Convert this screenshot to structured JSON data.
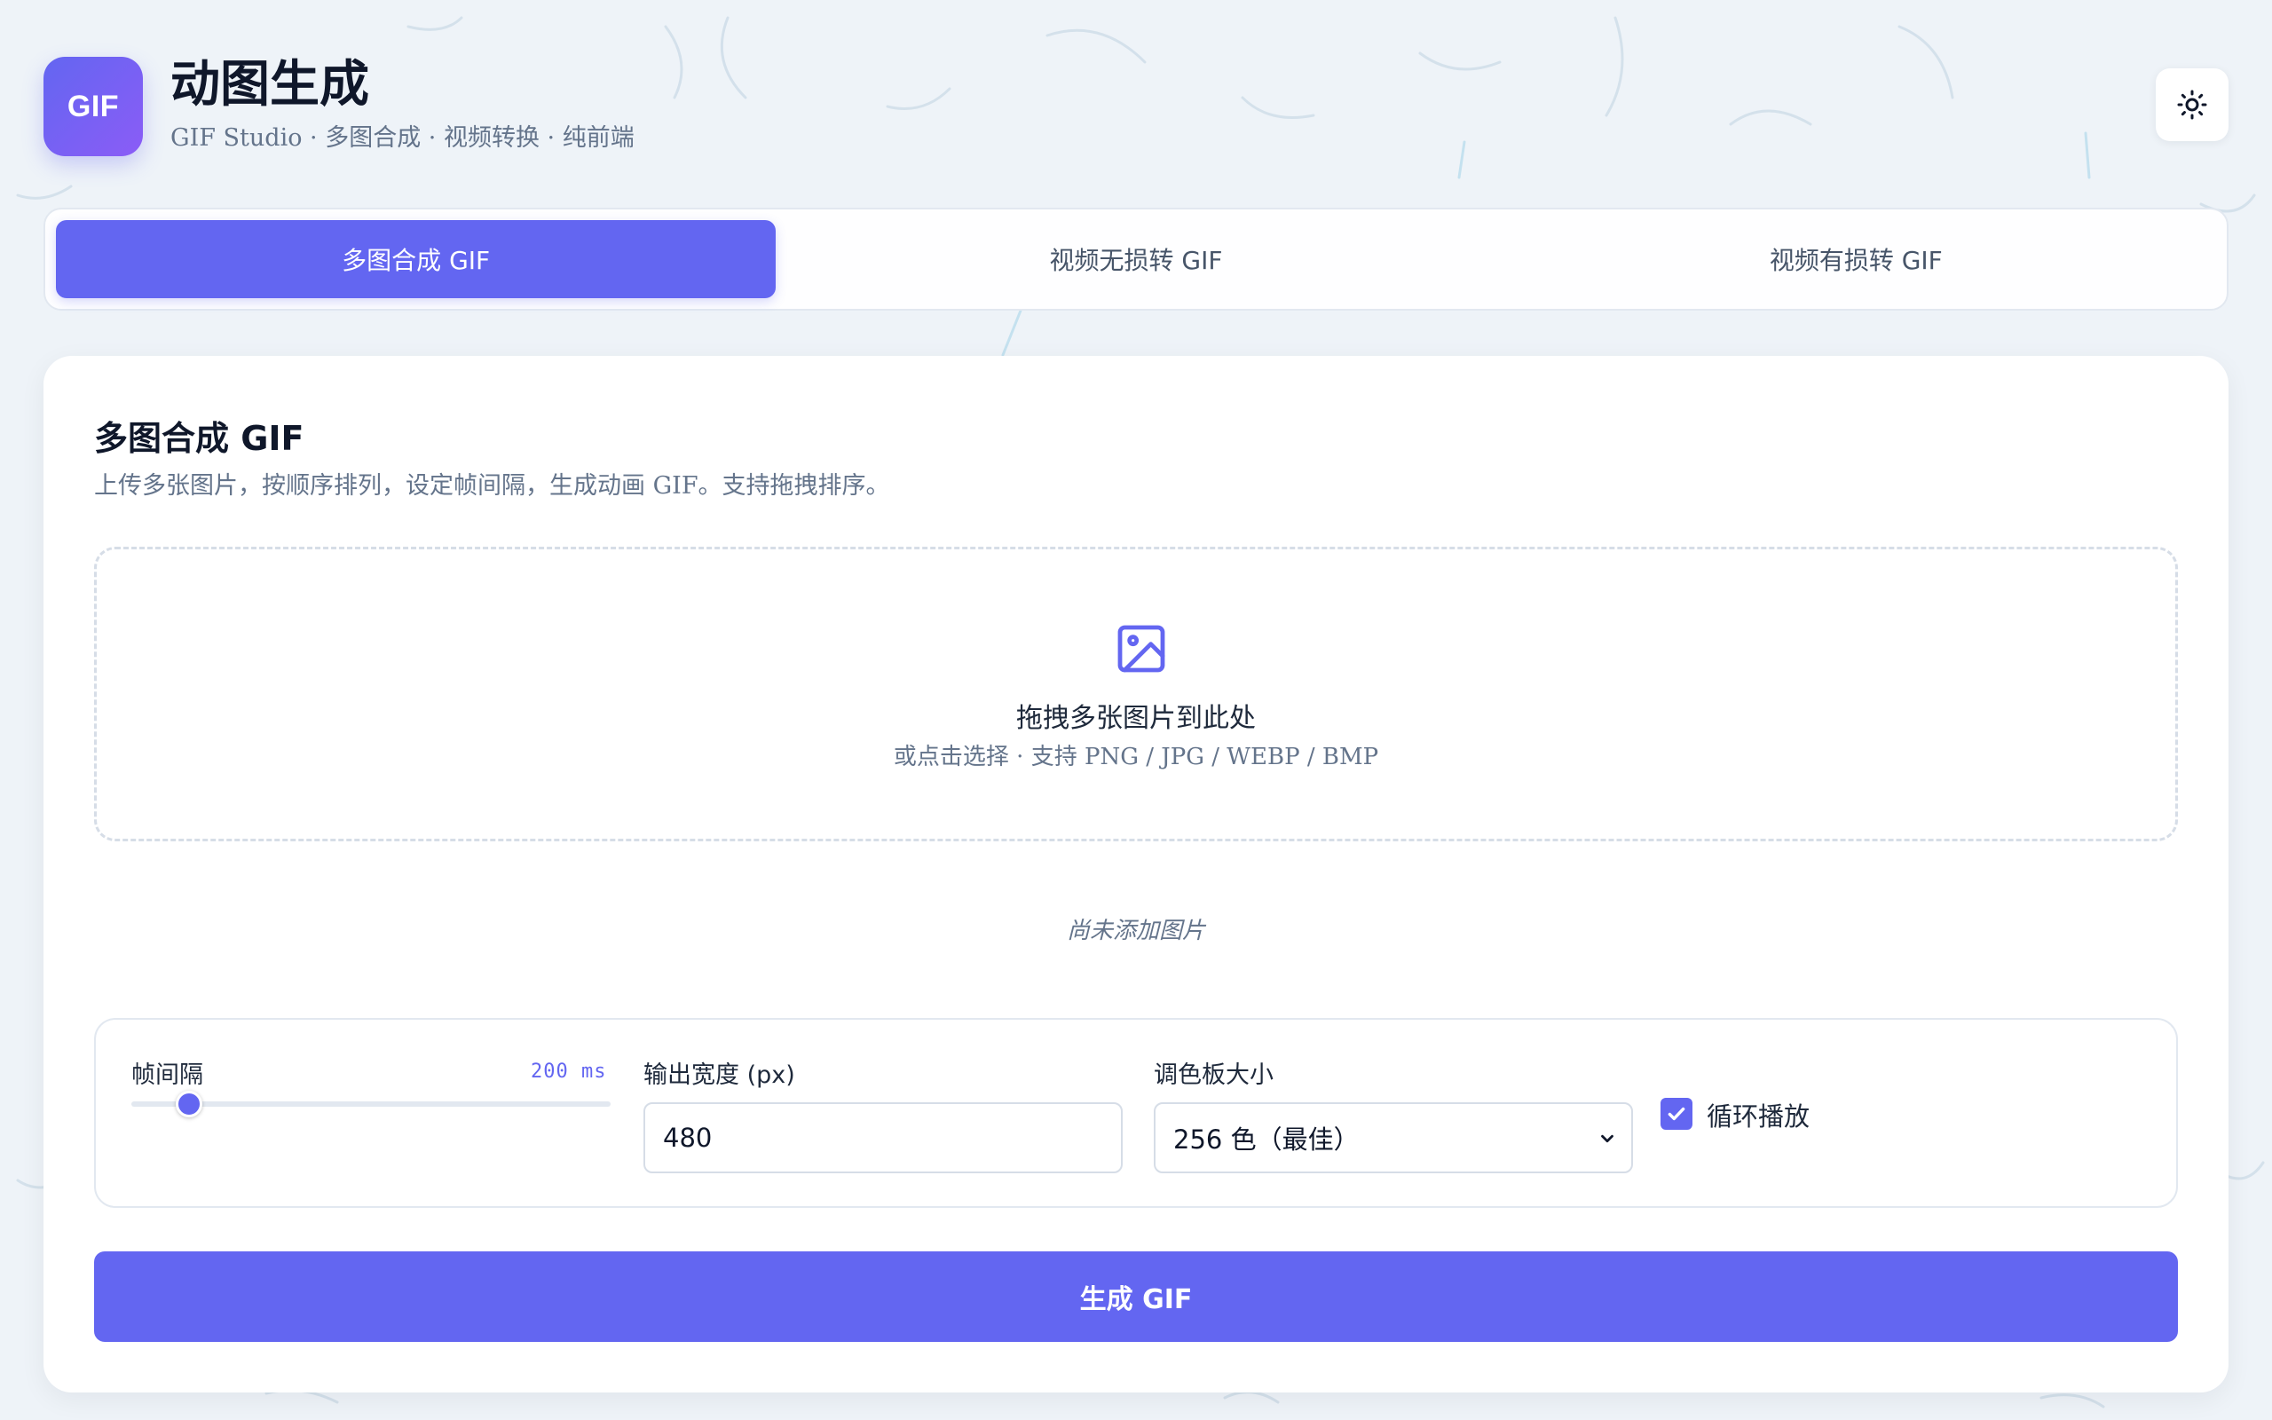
{
  "header": {
    "logo_text": "GIF",
    "title": "动图生成",
    "subtitle": "GIF Studio · 多图合成 · 视频转换 · 纯前端",
    "theme_icon": "sun-icon"
  },
  "tabs": [
    {
      "label": "多图合成 GIF",
      "active": true
    },
    {
      "label": "视频无损转 GIF",
      "active": false
    },
    {
      "label": "视频有损转 GIF",
      "active": false
    }
  ],
  "panel": {
    "title": "多图合成 GIF",
    "description": "上传多张图片，按顺序排列，设定帧间隔，生成动画 GIF。支持拖拽排序。",
    "dropzone": {
      "icon": "image-icon",
      "main_text": "拖拽多张图片到此处",
      "sub_text": "或点击选择 · 支持 PNG / JPG / WEBP / BMP"
    },
    "empty_text": "尚未添加图片"
  },
  "settings": {
    "interval_label": "帧间隔",
    "interval_value": "200 ms",
    "interval_fraction": 0.12,
    "width_label": "输出宽度 (px)",
    "width_value": "480",
    "palette_label": "调色板大小",
    "palette_value": "256 色（最佳）",
    "loop_label": "循环播放",
    "loop_checked": true
  },
  "actions": {
    "generate_label": "生成 GIF"
  },
  "colors": {
    "accent": "#6366f1",
    "background": "#eef3f8"
  }
}
